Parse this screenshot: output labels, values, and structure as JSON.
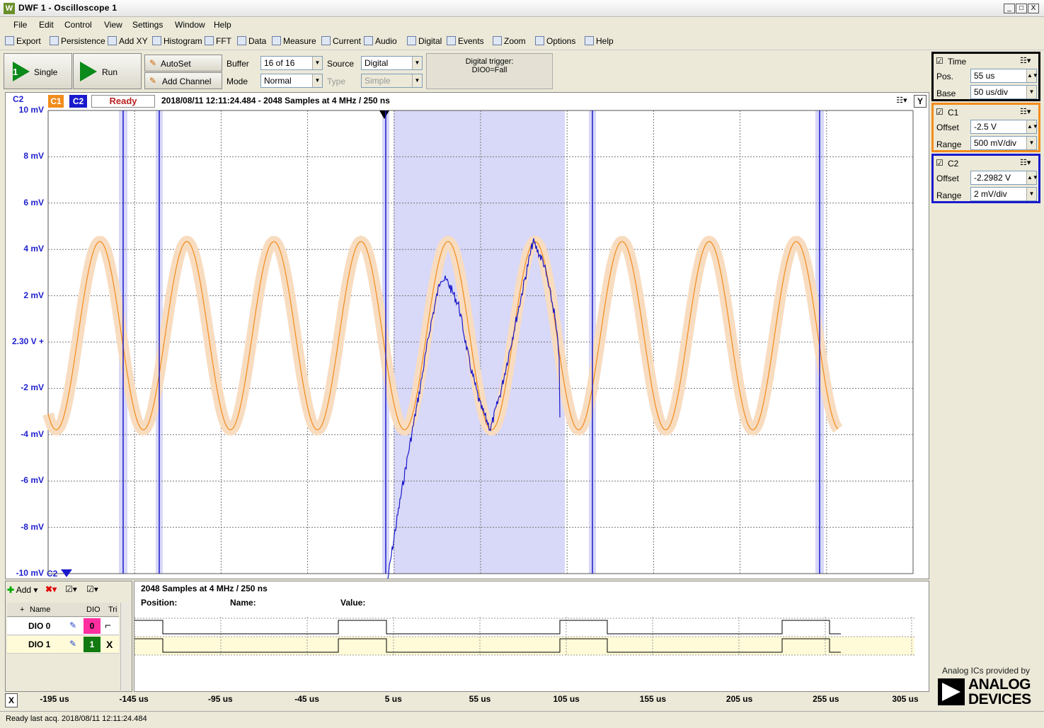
{
  "window": {
    "icon": "W",
    "title": "DWF 1 - Oscilloscope 1",
    "min": "_",
    "max": "□",
    "close": "X"
  },
  "menu": [
    "File",
    "Edit",
    "Control",
    "View",
    "Settings",
    "Window",
    "Help"
  ],
  "toolbar": [
    "Export",
    "Persistence",
    "Add XY",
    "Histogram",
    "FFT",
    "Data",
    "Measure",
    "Current",
    "Audio",
    "Digital",
    "Events",
    "Zoom",
    "Options",
    "Help"
  ],
  "controls": {
    "single_label": "Single",
    "single_badge": "1",
    "run_label": "Run",
    "autoset_label": "AutoSet",
    "addchannel_label": "Add Channel",
    "buffer_label": "Buffer",
    "buffer_value": "16 of 16",
    "mode_label": "Mode",
    "mode_value": "Normal",
    "source_label": "Source",
    "source_value": "Digital",
    "type_label": "Type",
    "type_value": "Simple",
    "trigger_label": "Digital trigger:",
    "trigger_value": "DIO0=Fall"
  },
  "plot": {
    "chan_label": "C2",
    "c1_tab": "C1",
    "c2_tab": "C2",
    "status": "Ready",
    "info": "2018/08/11 12:11:24.484 - 2048 Samples at 4 MHz / 250 ns",
    "ref_marker": "C2",
    "y_button": "Y",
    "y_ticks": [
      "10 mV",
      "8 mV",
      "6 mV",
      "4 mV",
      "2 mV",
      "2.30 V +",
      "-2 mV",
      "-4 mV",
      "-6 mV",
      "-8 mV",
      "-10 mV"
    ],
    "x_ticks": [
      "-195 us",
      "-145 us",
      "-95 us",
      "-45 us",
      "5 us",
      "55 us",
      "105 us",
      "155 us",
      "205 us",
      "255 us",
      "305 us"
    ],
    "colors": {
      "c1": "#f28c1c",
      "c2": "#1a1acc",
      "c1_env": "#f8dcc0",
      "c2_env": "#d8d8f8"
    }
  },
  "digital": {
    "add_label": "Add",
    "col_name": "Name",
    "col_dio": "DIO",
    "col_trig": "Tri",
    "info": "2048 Samples at 4 MHz / 250 ns",
    "position_label": "Position:",
    "name_label": "Name:",
    "value_label": "Value:",
    "rows": [
      {
        "name": "DIO 0",
        "pin": "0",
        "pin_color": "#ff2fa0",
        "trig": "⌐"
      },
      {
        "name": "DIO 1",
        "pin": "1",
        "pin_color": "#117a11",
        "trig": "X"
      }
    ]
  },
  "side": {
    "time": {
      "label": "Time",
      "pos_label": "Pos.",
      "pos_value": "55 us",
      "base_label": "Base",
      "base_value": "50 us/div"
    },
    "c1": {
      "label": "C1",
      "offset_label": "Offset",
      "offset_value": "-2.5 V",
      "range_label": "Range",
      "range_value": "500 mV/div",
      "color": "#f28c1c"
    },
    "c2": {
      "label": "C2",
      "offset_label": "Offset",
      "offset_value": "-2.2982 V",
      "range_label": "Range",
      "range_value": "2 mV/div",
      "color": "#1a1acc"
    },
    "logo_caption": "Analog ICs provided by",
    "logo_line1": "ANALOG",
    "logo_line2": "DEVICES"
  },
  "status": {
    "text": "Ready last acq. 2018/08/11 12:11:24.484"
  },
  "close_x": "X"
}
